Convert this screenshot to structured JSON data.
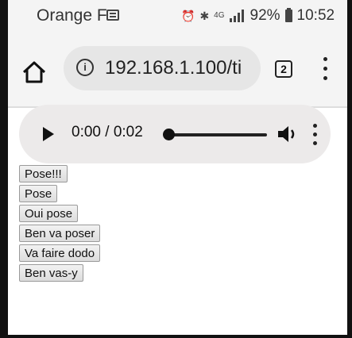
{
  "status_bar": {
    "carrier": "Orange F",
    "battery": "92%",
    "time": "10:52",
    "network": "4G"
  },
  "browser": {
    "url": "192.168.1.100/ti",
    "tab_count": "2",
    "icons": {
      "home": "home-icon",
      "info": "info-icon",
      "menu": "menu-dots-icon"
    }
  },
  "audio": {
    "time": "0:00 / 0:02",
    "progress": 0.0
  },
  "buttons": [
    {
      "label": "Pose!!!"
    },
    {
      "label": "Pose"
    },
    {
      "label": "Oui pose"
    },
    {
      "label": "Ben va poser"
    },
    {
      "label": "Va faire dodo"
    },
    {
      "label": "Ben vas-y"
    }
  ]
}
